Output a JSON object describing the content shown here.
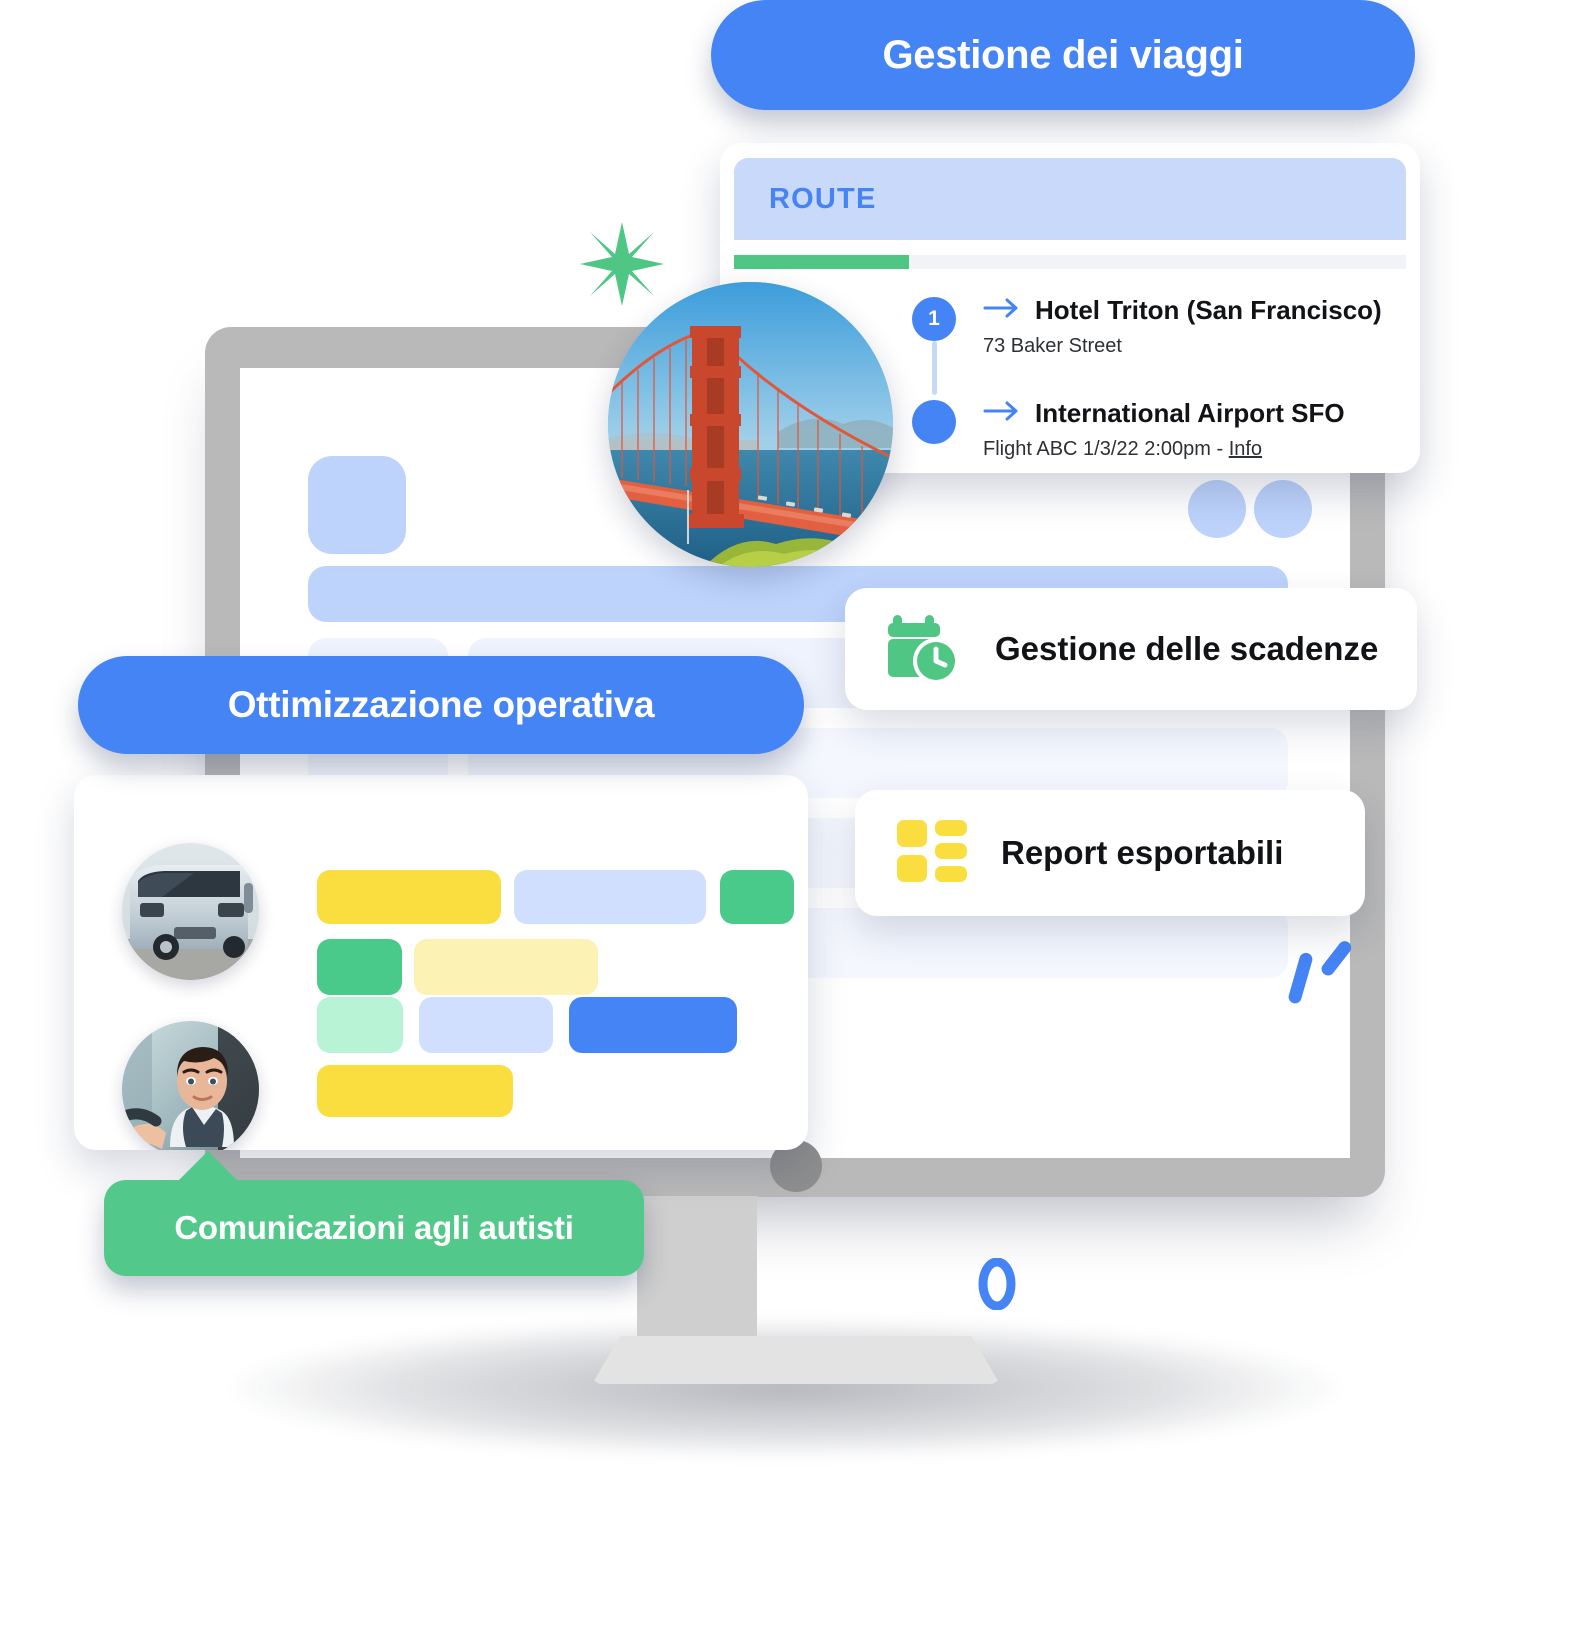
{
  "colors": {
    "brand_blue": "#4584f5",
    "brand_green": "#52c98b",
    "accent_yellow": "#fade3f",
    "skeleton_blue": "#cfdffd",
    "bezel_gray": "#b9b9b9"
  },
  "pills": {
    "trips": "Gestione dei viaggi",
    "operations": "Ottimizzazione operativa",
    "drivers": "Comunicazioni agli autisti"
  },
  "route_card": {
    "header_label": "ROUTE",
    "progress_percent": 26,
    "steps": [
      {
        "marker": "1",
        "title": "Hotel Triton (San Francisco)",
        "subtitle": "73 Baker Street",
        "subtitle_link": ""
      },
      {
        "marker": "",
        "title": "International Airport SFO",
        "subtitle": "Flight ABC 1/3/22 2:00pm - ",
        "subtitle_link": "Info"
      }
    ]
  },
  "feature_cards": [
    {
      "icon": "calendar-clock-icon",
      "label": "Gestione delle scadenze",
      "color": "#4fc684"
    },
    {
      "icon": "report-grid-icon",
      "label": "Report esportabili",
      "color": "#fade3f"
    }
  ],
  "list_card": {
    "rows": [
      {
        "avatar": "coach-bus-photo",
        "bars": [
          "yellow",
          "light-blue",
          "green",
          "green",
          "pale-yellow"
        ]
      },
      {
        "avatar": "driver-portrait-photo",
        "bars": [
          "pale-green",
          "light-blue",
          "blue",
          "yellow"
        ]
      }
    ]
  },
  "decorations": {
    "star": "green-sparkle-icon",
    "dashes": "blue-dashes-icon",
    "ring": "blue-ring-icon"
  },
  "device": {
    "type": "desktop-monitor"
  }
}
